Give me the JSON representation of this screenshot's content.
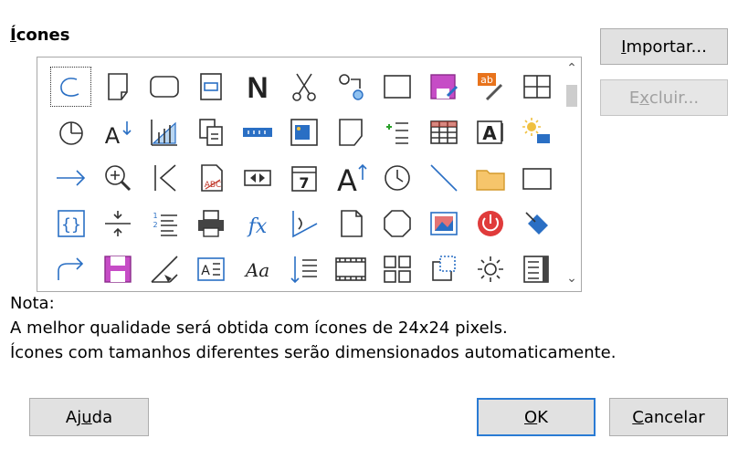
{
  "section": {
    "title_first": "Í",
    "title_rest": "cones"
  },
  "buttons": {
    "import": {
      "label": "Importar...",
      "mnemonic_first": "I",
      "mnemonic_rest": "mportar..."
    },
    "delete": {
      "label": "Excluir...",
      "pre": "E",
      "mn": "x",
      "post": "cluir..."
    },
    "help": {
      "pre": "Aj",
      "mn": "u",
      "post": "da"
    },
    "ok": {
      "mn": "O",
      "post": "K"
    },
    "cancel": {
      "mn": "C",
      "post": "ancelar"
    }
  },
  "note": {
    "heading": "Nota:",
    "line1": "A melhor qualidade será obtida com ícones de 24x24 pixels.",
    "line2": "Ícones com tamanhos diferentes serão dimensionados automaticamente."
  },
  "icons": [
    [
      "lasso-selection-icon",
      "page-icon",
      "rounded-rectangle-icon",
      "form-field-icon",
      "bold-N-icon",
      "scissors-icon",
      "macro-settings-icon",
      "rectangle-icon",
      "save-edit-icon",
      "edit-text-icon",
      "table-icon"
    ],
    [
      "pie-chart-icon",
      "sort-text-icon",
      "chart-area-icon",
      "copy-page-icon",
      "progress-bar-icon",
      "image-frame-icon",
      "folded-page-icon",
      "insert-list-icon",
      "table-grid-icon",
      "text-field-icon",
      "sun-display-icon"
    ],
    [
      "arrow-right-icon",
      "zoom-in-icon",
      "first-page-icon",
      "signed-document-icon",
      "media-controls-icon",
      "calendar-icon",
      "grow-font-icon",
      "clock-icon",
      "line-icon",
      "folder-icon",
      "frame-icon"
    ],
    [
      "braces-icon",
      "spacing-icon",
      "numbered-list-icon",
      "printer-icon",
      "fx-icon",
      "angle-icon",
      "blank-page-icon",
      "octagon-icon",
      "image-insert-icon",
      "power-icon",
      "fill-bucket-icon"
    ],
    [
      "redo-arrow-icon",
      "floppy-save-icon",
      "3d-object-icon",
      "text-box-icon",
      "font-style-icon",
      "line-spacing-icon",
      "film-strip-icon",
      "layout-grid-icon",
      "frame-anchor-icon",
      "gear-settings-icon",
      "navigator-icon"
    ]
  ],
  "colors": {
    "accent": "#2a7bd4",
    "icon_blue": "#2a6fc4"
  }
}
